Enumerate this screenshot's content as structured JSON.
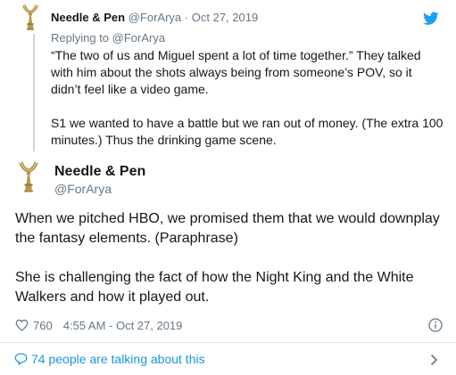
{
  "parent_tweet": {
    "author_name": "Needle & Pen",
    "handle": "@ForArya",
    "separator": "·",
    "date": "Oct 27, 2019",
    "replying_prefix": "Replying to",
    "replying_handle": "@ForArya",
    "paragraphs": [
      "“The two of us and Miguel spent a lot of time together.” They talked with him about the shots always being from someone’s POV, so it didn’t feel like a video game.",
      "S1 we wanted to have a battle but we ran out of money. (The extra 100 minutes.) Thus the drinking game scene."
    ]
  },
  "main_tweet": {
    "author_name": "Needle & Pen",
    "handle": "@ForArya",
    "paragraphs": [
      "When we pitched HBO, we promised them that we would downplay the fantasy elements. (Paraphrase)",
      "She is challenging the fact of how the Night King and the White Walkers and how it played out."
    ],
    "like_count": "760",
    "timestamp": "4:55 AM - Oct 27, 2019"
  },
  "conversation": {
    "label": "74 people are talking about this"
  },
  "colors": {
    "accent": "#1da1f2",
    "link": "#1b95e0",
    "muted": "#657786",
    "text": "#14171a",
    "avatar_gold": "#b8974a"
  },
  "icons": [
    "emmy-statuette-icon",
    "twitter-bird-icon",
    "heart-icon",
    "info-icon",
    "speech-bubble-icon",
    "chevron-right-icon"
  ]
}
